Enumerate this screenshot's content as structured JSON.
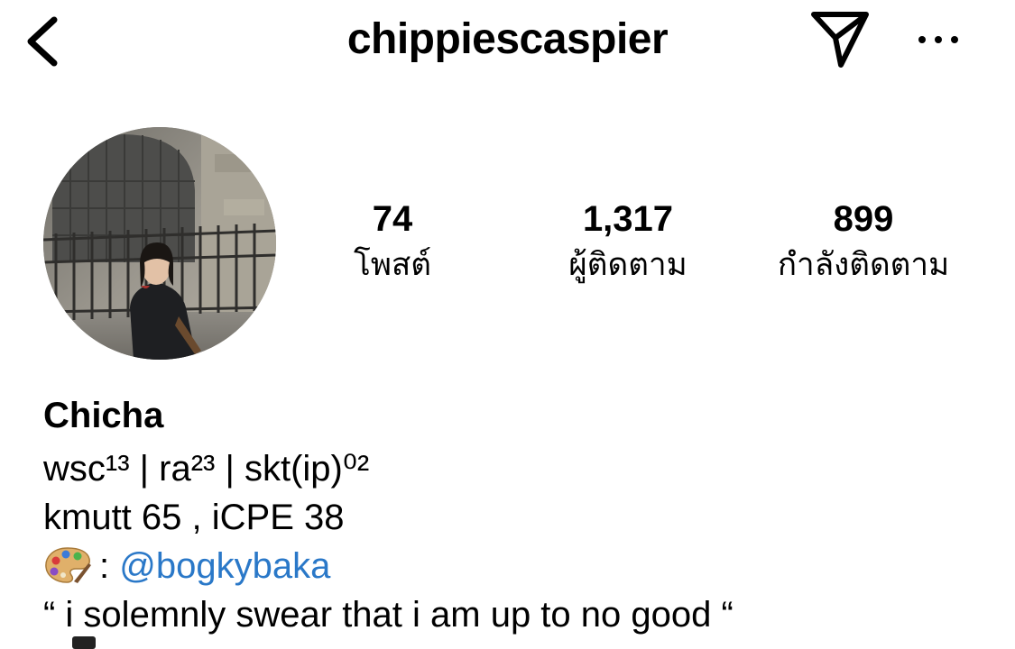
{
  "header": {
    "username": "chippiescaspier",
    "back_icon": "chevron-left-icon",
    "send_icon": "paper-plane-icon",
    "more_icon": "more-horizontal-icon"
  },
  "stats": {
    "posts": {
      "count": "74",
      "label": "โพสต์"
    },
    "followers": {
      "count": "1,317",
      "label": "ผู้ติดตาม"
    },
    "following": {
      "count": "899",
      "label": "กำลังติดตาม"
    }
  },
  "bio": {
    "name": "Chicha",
    "line1": "wsc¹³ | ra²³ | skt(ip)⁰²",
    "line2": "kmutt 65 , iCPE 38",
    "line3_prefix": ": ",
    "line3_mention": "@bogkybaka",
    "line4": "“ i solemnly swear that i am up to no good “",
    "palette_icon": "artist-palette-icon"
  },
  "colors": {
    "link": "#2a78c8",
    "text": "#000000",
    "background": "#ffffff"
  }
}
